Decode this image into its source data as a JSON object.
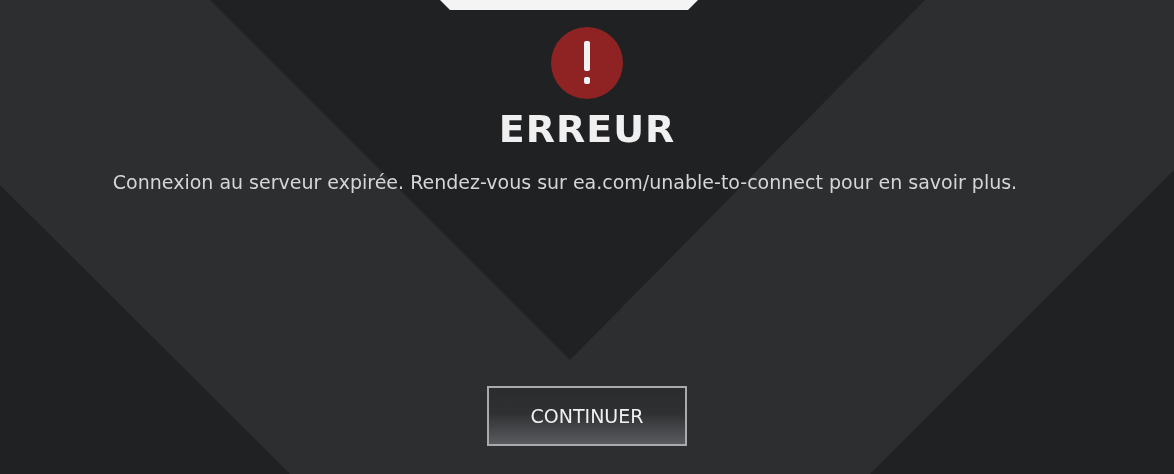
{
  "dialog": {
    "title": "ERREUR",
    "message": "Connexion au serveur expirée. Rendez-vous sur ea.com/unable-to-connect pour en savoir plus.",
    "buttons": [
      {
        "label": "CONTINUER"
      }
    ]
  }
}
